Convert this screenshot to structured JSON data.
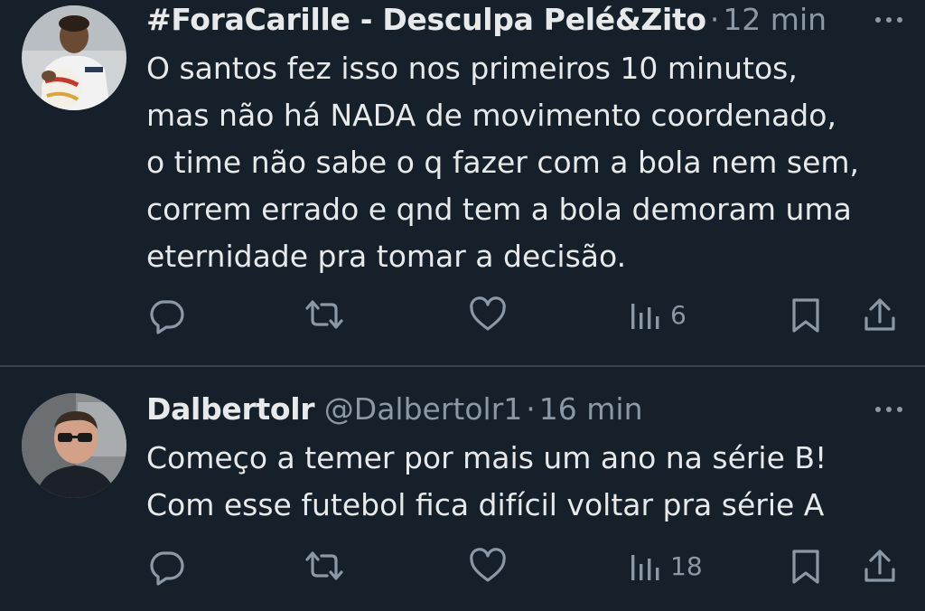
{
  "tweets": [
    {
      "name": "#ForaCarille - Desculpa Pelé&Zito",
      "handle": "",
      "separator": "·",
      "time": "12 min",
      "body_lines": [
        "O santos fez isso nos primeiros 10 minutos,",
        "mas não há NADA de movimento coordenado,",
        "o time não sabe o q fazer com a bola nem sem,",
        "correm errado e qnd tem a bola demoram uma",
        "eternidade pra tomar a decisão."
      ],
      "views": "6"
    },
    {
      "name": "Dalbertolr",
      "handle": "@Dalbertolr1",
      "separator": "·",
      "time": "16 min",
      "body_lines": [
        "Começo a temer por mais um ano na série B!",
        "Com esse futebol fica difícil voltar pra série A"
      ],
      "views": "18"
    }
  ],
  "icons": {
    "reply": "reply-icon",
    "retweet": "retweet-icon",
    "like": "like-icon",
    "views": "views-icon",
    "bookmark": "bookmark-icon",
    "share": "share-icon",
    "more": "more-icon"
  },
  "colors": {
    "background": "#15202b",
    "text": "#e7e9ea",
    "muted": "#8b98a5",
    "divider": "#38444d"
  }
}
